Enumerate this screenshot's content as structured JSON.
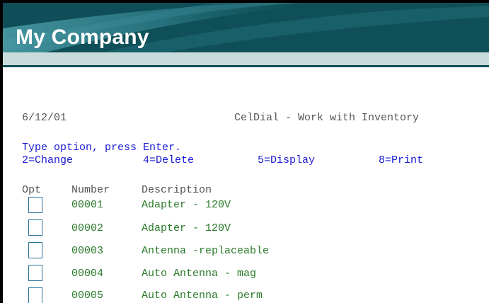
{
  "header": {
    "app_title": "My Company"
  },
  "screen": {
    "date": "6/12/01",
    "title": "CelDial - Work with Inventory",
    "instruction": "Type option, press Enter.",
    "options": [
      {
        "label": "2=Change"
      },
      {
        "label": "4=Delete"
      },
      {
        "label": "5=Display"
      },
      {
        "label": "8=Print"
      }
    ],
    "columns": {
      "opt": "Opt",
      "number": "Number",
      "description": "Description"
    },
    "rows": [
      {
        "number": "00001",
        "description": "Adapter - 120V"
      },
      {
        "number": "00002",
        "description": "Adapter - 120V"
      },
      {
        "number": "00003",
        "description": "Antenna -replaceable"
      },
      {
        "number": "00004",
        "description": "Auto Antenna - mag"
      },
      {
        "number": "00005",
        "description": "Auto Antenna - perm"
      }
    ]
  },
  "colors": {
    "header_bg": "#0f4f58",
    "band": "#c9dcdc",
    "instruction_text": "#1a1ad6",
    "data_text": "#2a7a2a",
    "label_text": "#555555"
  }
}
